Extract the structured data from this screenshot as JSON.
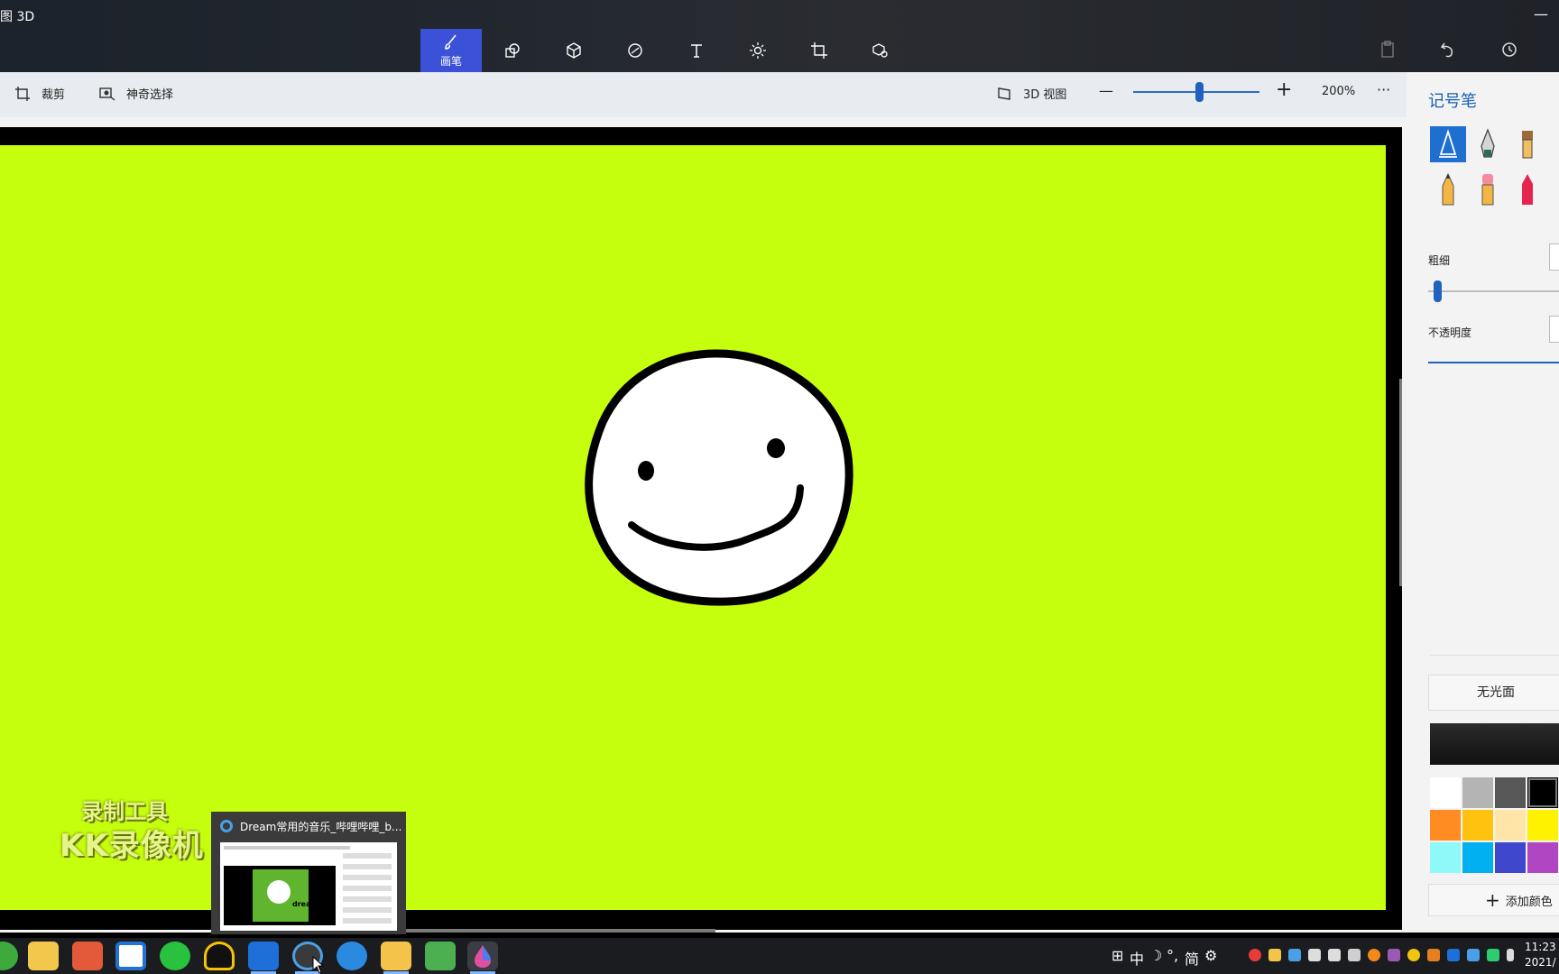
{
  "app": {
    "title": "图 3D",
    "minimize_label": "—"
  },
  "toolbar": {
    "tools": [
      {
        "id": "brushes",
        "label": "画笔",
        "icon": "brush-icon",
        "active": true
      },
      {
        "id": "2d-shapes",
        "label": "",
        "icon": "2d-shapes-icon",
        "active": false
      },
      {
        "id": "3d-shapes",
        "label": "",
        "icon": "3d-cube-icon",
        "active": false
      },
      {
        "id": "stickers",
        "label": "",
        "icon": "sticker-icon",
        "active": false
      },
      {
        "id": "text",
        "label": "",
        "icon": "text-t-icon",
        "active": false
      },
      {
        "id": "effects",
        "label": "",
        "icon": "sun-effects-icon",
        "active": false
      },
      {
        "id": "canvas",
        "label": "",
        "icon": "canvas-crop-icon",
        "active": false
      },
      {
        "id": "3d-library",
        "label": "",
        "icon": "3d-library-icon",
        "active": false
      }
    ],
    "right_icons": [
      "paste-icon",
      "undo-icon",
      "history-icon"
    ]
  },
  "commandbar": {
    "crop_label": "裁剪",
    "magic_select_label": "神奇选择",
    "view3d_label": "3D 视图",
    "zoom_minus": "—",
    "zoom_plus": "+",
    "zoom_value": "200%",
    "more_label": "···",
    "zoom_fraction": 0.52
  },
  "watermark": {
    "line1": "录制工具",
    "line2": "KK录像机"
  },
  "thumbnail": {
    "title": "Dream常用的音乐_哔哩哔哩_b...",
    "preview_word": "dream"
  },
  "panel": {
    "title": "记号笔",
    "brushes": [
      "marker-icon",
      "calligraphy-pen-icon",
      "oil-brush-icon",
      "pencil-icon",
      "eraser-icon",
      "crayon-icon"
    ],
    "thickness_label": "粗细",
    "opacity_label": "不透明度",
    "finish_label": "无光面",
    "add_color_label": "添加颜色",
    "selected_color": "#111111",
    "swatches": [
      "#ffffff",
      "#b4b4b4",
      "#585858",
      "#000000",
      "#ff8c22",
      "#ffc20e",
      "#ffe6a8",
      "#fff200",
      "#8ff8f8",
      "#00b0f0",
      "#3f48cc",
      "#b146c2"
    ]
  },
  "taskbar": {
    "tray_glyphs": [
      "⊞",
      "中",
      "☽",
      "°,",
      "简",
      "⚙"
    ],
    "clock_time": "11:23",
    "clock_date": "2021/"
  },
  "colors": {
    "canvas_green": "#c6ff0e",
    "accent": "#3b52d8",
    "panel_title": "#1a5fb4"
  }
}
